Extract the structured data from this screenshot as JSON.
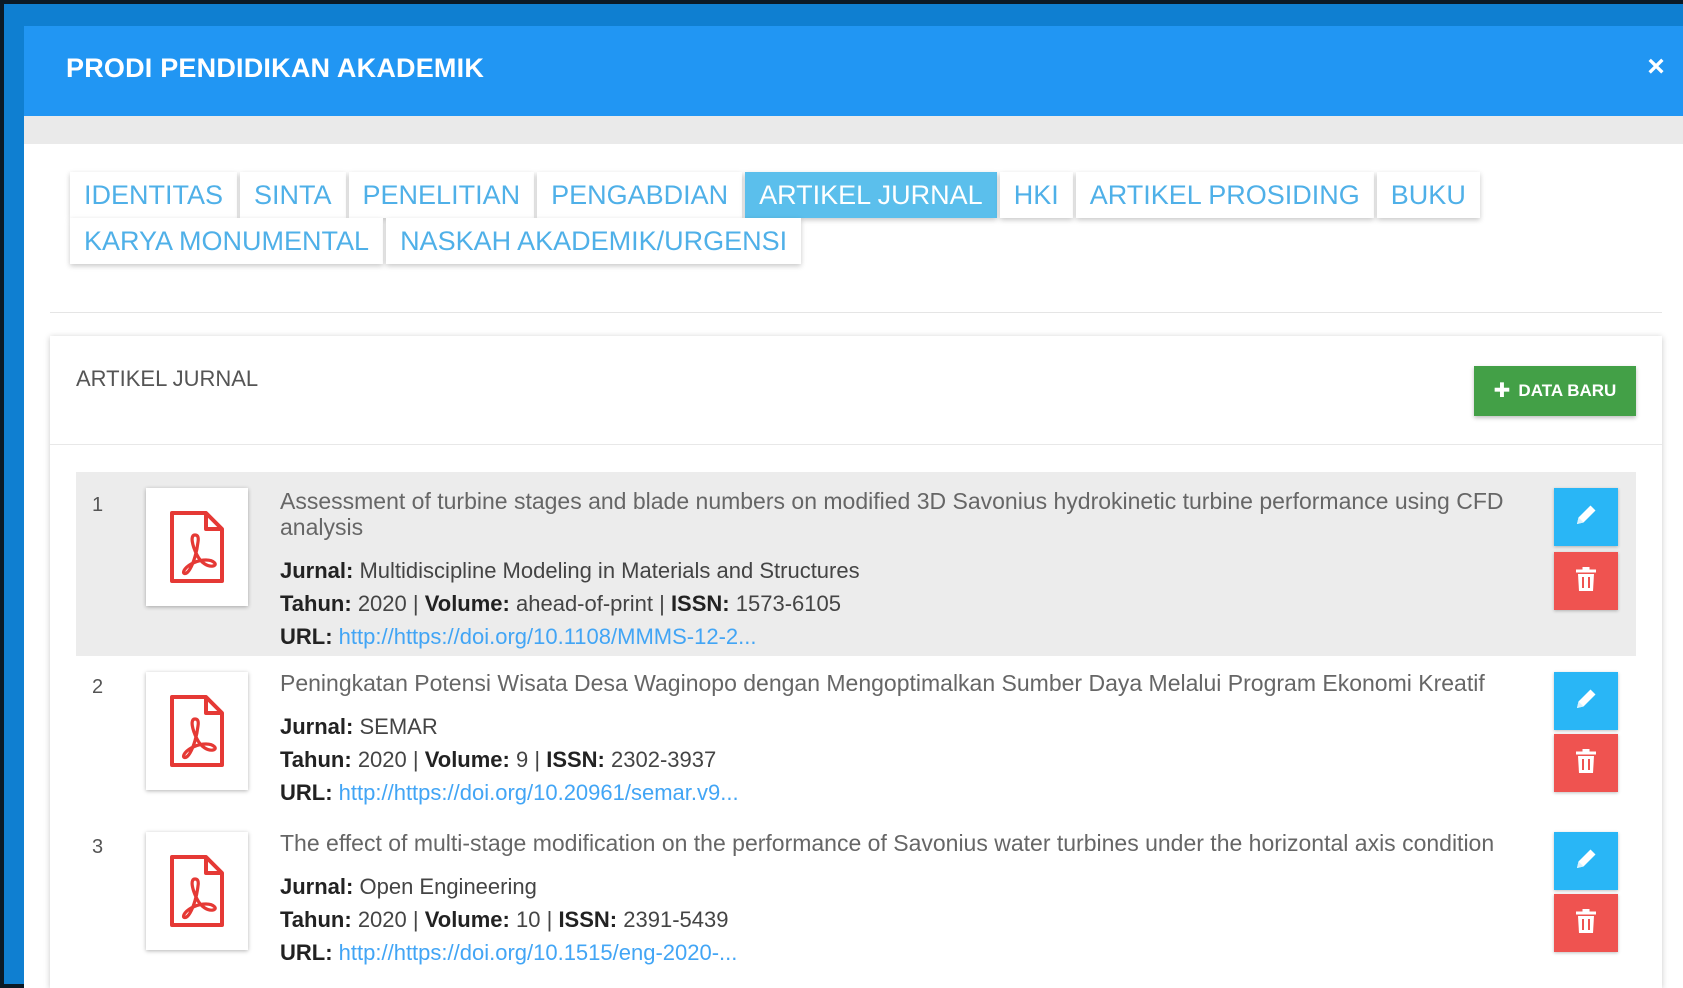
{
  "modal": {
    "title": "PRODI PENDIDIKAN AKADEMIK",
    "close_label": "×"
  },
  "tabs": {
    "row1": [
      "IDENTITAS",
      "SINTA",
      "PENELITIAN",
      "PENGABDIAN",
      "ARTIKEL JURNAL",
      "HKI",
      "ARTIKEL PROSIDING",
      "BUKU"
    ],
    "row2": [
      "KARYA MONUMENTAL",
      "NASKAH AKADEMIK/URGENSI"
    ],
    "active": "ARTIKEL JURNAL"
  },
  "card": {
    "title": "ARTIKEL JURNAL",
    "add_button": "DATA BARU"
  },
  "labels": {
    "jurnal": "Jurnal:",
    "tahun": "Tahun:",
    "volume": "Volume:",
    "issn": "ISSN:",
    "url": "URL:",
    "separator": "|"
  },
  "colors": {
    "header": "#2196f3",
    "active_tab": "#5bbfec",
    "add_button": "#43a047",
    "edit_button": "#29b6f6",
    "delete_button": "#ef5350",
    "pdf_icon": "#e53935"
  },
  "icons": {
    "document": "pdf-icon",
    "edit": "pencil-icon",
    "delete": "trash-icon",
    "add": "plus-icon",
    "close": "close-icon"
  },
  "articles": [
    {
      "number": "1",
      "title": "Assessment of turbine stages and blade numbers on modified 3D Savonius hydrokinetic turbine performance using CFD analysis",
      "jurnal": "Multidiscipline Modeling in Materials and Structures",
      "tahun": "2020",
      "volume": "ahead-of-print",
      "issn": "1573-6105",
      "url": "http://https://doi.org/10.1108/MMMS-12-2...",
      "highlighted": true
    },
    {
      "number": "2",
      "title": "Peningkatan Potensi Wisata Desa Waginopo dengan Mengoptimalkan Sumber Daya Melalui Program Ekonomi Kreatif",
      "jurnal": "SEMAR",
      "tahun": "2020",
      "volume": "9",
      "issn": "2302-3937",
      "url": "http://https://doi.org/10.20961/semar.v9...",
      "highlighted": false
    },
    {
      "number": "3",
      "title": "The effect of multi-stage modification on the performance of Savonius water turbines under the horizontal axis condition",
      "jurnal": "Open Engineering",
      "tahun": "2020",
      "volume": "10",
      "issn": "2391-5439",
      "url": "http://https://doi.org/10.1515/eng-2020-...",
      "highlighted": false
    }
  ]
}
